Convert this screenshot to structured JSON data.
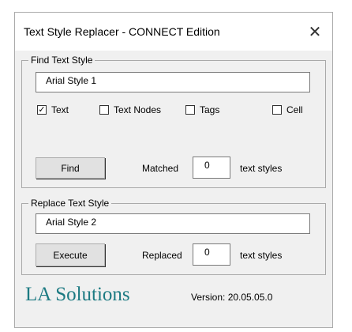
{
  "window": {
    "title": "Text Style Replacer - CONNECT Edition",
    "close_glyph": "✕"
  },
  "find": {
    "legend": "Find Text Style",
    "input_value": "Arial Style 1",
    "checkboxes": [
      {
        "label": "Text",
        "checked": true,
        "mark": "✓"
      },
      {
        "label": "Text Nodes",
        "checked": false,
        "mark": ""
      },
      {
        "label": "Tags",
        "checked": false,
        "mark": ""
      },
      {
        "label": "Cell",
        "checked": false,
        "mark": ""
      }
    ],
    "button_label": "Find",
    "count_label": "Matched",
    "count_value": "0",
    "suffix": "text styles"
  },
  "replace": {
    "legend": "Replace Text Style",
    "input_value": "Arial Style 2",
    "button_label": "Execute",
    "count_label": "Replaced",
    "count_value": "0",
    "suffix": "text styles"
  },
  "footer": {
    "brand": "LA Solutions",
    "version": "Version: 20.05.05.0",
    "brand_color": "#1c7a82"
  }
}
